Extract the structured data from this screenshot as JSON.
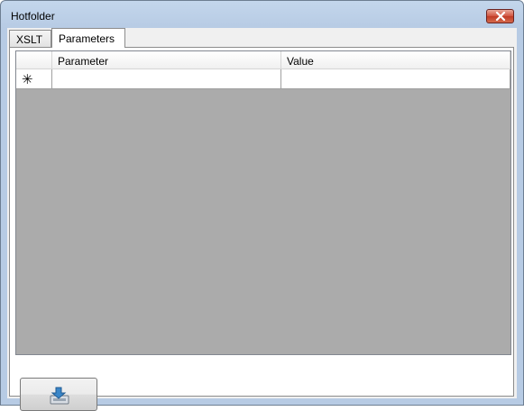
{
  "window": {
    "title": "Hotfolder"
  },
  "tabs": [
    {
      "label": "XSLT",
      "active": false
    },
    {
      "label": "Parameters",
      "active": true
    }
  ],
  "grid": {
    "columns": [
      "Parameter",
      "Value"
    ],
    "new_row_marker": "✳",
    "rows": [
      {
        "parameter": "",
        "value": ""
      }
    ]
  },
  "icons": {
    "close": "close-icon",
    "import": "import-icon"
  },
  "colors": {
    "grid_background": "#ababab",
    "close_button": "#c9452f"
  }
}
